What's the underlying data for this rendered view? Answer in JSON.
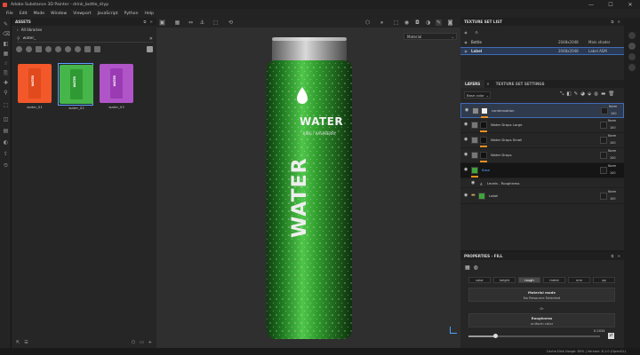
{
  "window": {
    "title": "Adobe Substance 3D Painter - drink_bottle_dryp",
    "min": "—",
    "max": "☐",
    "close": "✕"
  },
  "menu": [
    "File",
    "Edit",
    "Mode",
    "Window",
    "Viewport",
    "JavaScript",
    "Python",
    "Help"
  ],
  "assets": {
    "title": "ASSETS",
    "library": "All libraries",
    "search_value": "water_",
    "items": [
      {
        "caption": "water_01",
        "color": "#f2582a",
        "selected": false
      },
      {
        "caption": "water_02",
        "color": "#46b54a",
        "selected": true
      },
      {
        "caption": "water_03",
        "color": "#b055c8",
        "selected": false
      }
    ],
    "pack_label": "WATER"
  },
  "viewport": {
    "material_mode": "Material",
    "bottle_label_big": "WATER",
    "bottle_label_small": "WATER",
    "bottle_sub": "KING / RASPBERRY",
    "bottle_color": "#2f9a2c"
  },
  "texture_set_list": {
    "title": "TEXTURE SET LIST",
    "rows": [
      {
        "name": "Bottle",
        "size": "2048x2048",
        "shader": "Main shader"
      },
      {
        "name": "Label",
        "size": "2048x2048",
        "shader": "Label ASM"
      }
    ]
  },
  "layers": {
    "tab_layers": "LAYERS",
    "tab_settings": "TEXTURE SET SETTINGS",
    "channel": "Base color",
    "list": [
      {
        "name": "condensation",
        "blend": "Norm",
        "opacity": "100"
      },
      {
        "name": "Water Drops Large",
        "blend": "Norm",
        "opacity": "100"
      },
      {
        "name": "Water Drops Small",
        "blend": "Norm",
        "opacity": "100"
      },
      {
        "name": "Water Drops",
        "blend": "Norm",
        "opacity": "100"
      },
      {
        "name": "Base",
        "blend": "Norm",
        "opacity": "100"
      }
    ],
    "sublayer": "Levels - Roughness",
    "folder": {
      "name": "Label",
      "blend": "Norm",
      "opacity": "100"
    }
  },
  "properties": {
    "title": "PROPERTIES - FILL",
    "channels": [
      "color",
      "height",
      "rough",
      "metal",
      "nrm",
      "ap"
    ],
    "active_channel": "rough",
    "material_mode_title": "Material mode",
    "material_mode_value": "No Resource Selected",
    "or_label": "Or",
    "roughness_title": "Roughness",
    "roughness_mode": "uniform color",
    "roughness_value": "0.2034",
    "roughness_fraction": 0.2034
  },
  "status": "Cache Disk Usage:  80% | Version: 8.1.0 (OpenGL)",
  "colors": {
    "accent": "#e88f21",
    "panel": "#262626",
    "selection": "#2e66c7"
  }
}
